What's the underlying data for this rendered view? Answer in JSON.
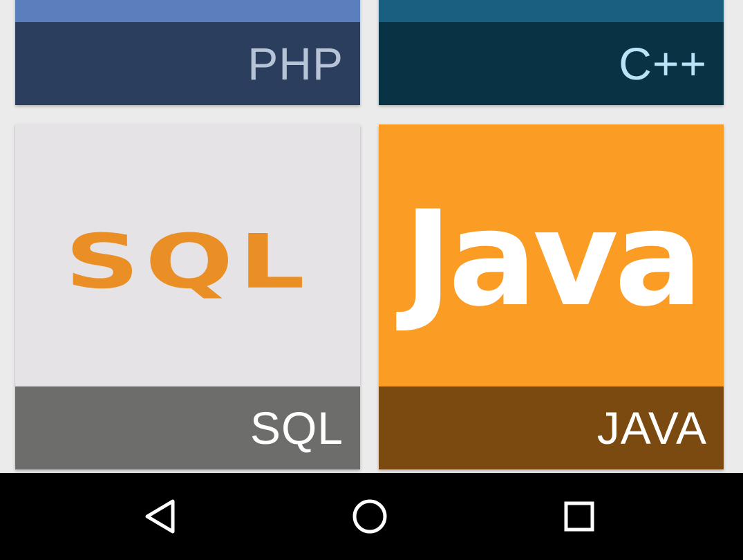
{
  "tiles": [
    {
      "id": "php",
      "caption": "PHP",
      "art_color": "#5b7fbd",
      "caption_bg": "#2c3e5e",
      "caption_color": "#b7c4d8"
    },
    {
      "id": "cpp",
      "caption": "C++",
      "art_color": "#1a5f80",
      "caption_bg": "#083345",
      "caption_color": "#b9e4f7"
    },
    {
      "id": "sql",
      "caption": "SQL",
      "logo_text": "SQL",
      "art_color": "#e5e3e6",
      "logo_color": "#e98f25",
      "caption_bg": "#6d6e6b",
      "caption_color": "#ffffff"
    },
    {
      "id": "java",
      "caption": "JAVA",
      "logo_text": "Java",
      "art_color": "#fb9c24",
      "logo_color": "#ffffff",
      "caption_bg": "#7b4a10",
      "caption_color": "#ffffff"
    }
  ],
  "navbar": {
    "background": "#000000",
    "buttons": [
      {
        "name": "back",
        "icon": "triangle-back-icon"
      },
      {
        "name": "home",
        "icon": "circle-home-icon"
      },
      {
        "name": "recents",
        "icon": "square-recents-icon"
      }
    ]
  }
}
